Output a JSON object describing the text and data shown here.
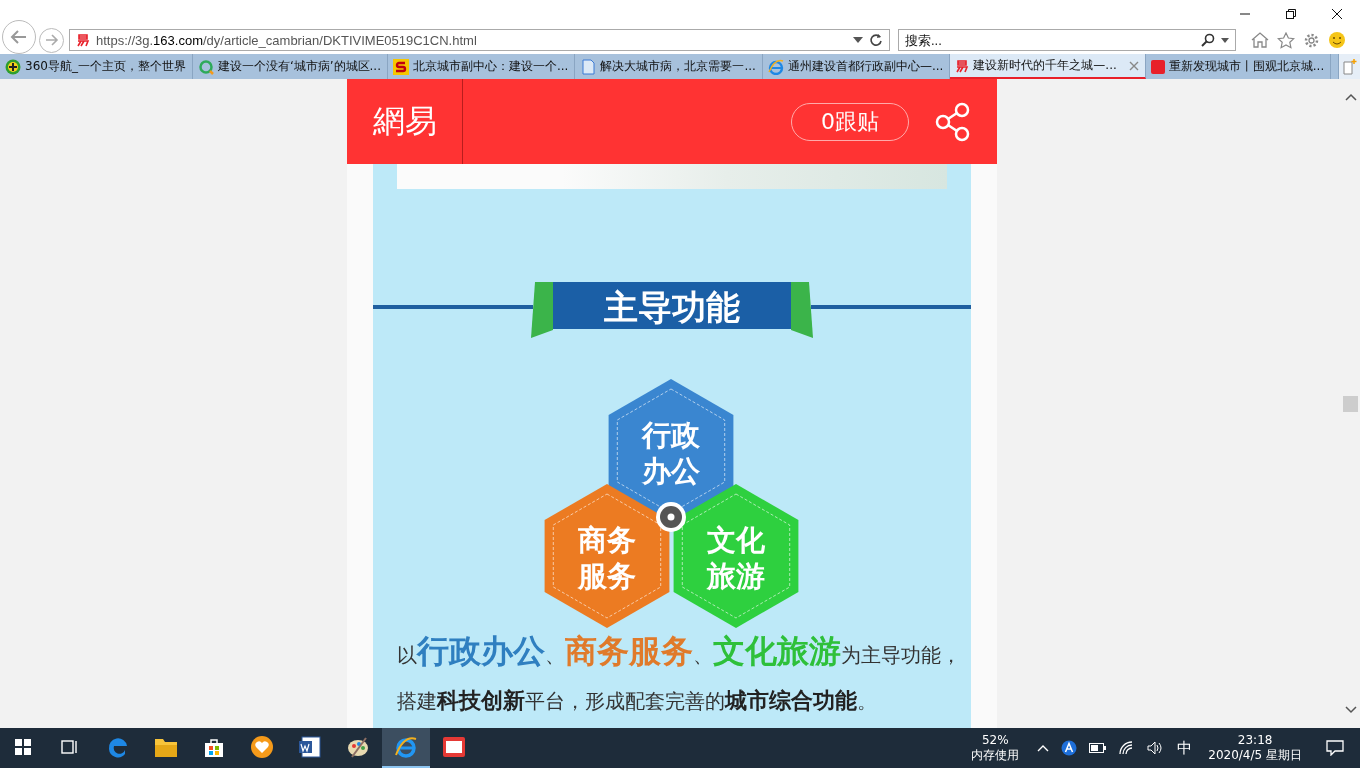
{
  "address_bar": {
    "url_prefix": "https://3g.",
    "url_domain": "163.com",
    "url_path": "/dy/article_cambrian/DKTIVIME0519C1CN.html"
  },
  "search": {
    "placeholder": "搜索..."
  },
  "tabs": [
    {
      "kind": "plus",
      "title": "360导航_一个主页，整个世界",
      "selected": false
    },
    {
      "kind": "ring",
      "title": "建设一个没有‘城市病’的城区...",
      "selected": false
    },
    {
      "kind": "s",
      "title": "北京城市副中心：建设一个...",
      "selected": false
    },
    {
      "kind": "doc",
      "title": "解决大城市病，北京需要一...",
      "selected": false
    },
    {
      "kind": "ie",
      "title": "通州建设首都行政副中心—...",
      "selected": false
    },
    {
      "kind": "netease",
      "title": "建设新时代的千年之城—...",
      "selected": true
    },
    {
      "kind": "toutiao",
      "title": "重新发现城市丨围观北京城...",
      "selected": false
    }
  ],
  "header": {
    "logo": "網易",
    "comments": "0跟贴"
  },
  "infographic": {
    "title": "主导功能",
    "hexagons": [
      {
        "lines": [
          "行政",
          "办公"
        ],
        "color": "#3a86d0"
      },
      {
        "lines": [
          "商务",
          "服务"
        ],
        "color": "#ec7b22"
      },
      {
        "lines": [
          "文化",
          "旅游"
        ],
        "color": "#2ed03f"
      }
    ],
    "paragraph": [
      {
        "text": "以",
        "bold": false
      },
      {
        "text": "行政办公",
        "bold": true,
        "color": "#2f7fc0"
      },
      {
        "text": "、",
        "bold": false
      },
      {
        "text": "商务服务",
        "bold": true,
        "color": "#e07a2a"
      },
      {
        "text": "、",
        "bold": false
      },
      {
        "text": "文化旅游",
        "bold": true,
        "color": "#2ec03a"
      },
      {
        "text": "为主导功能，搭建",
        "bold": false
      },
      {
        "text": "科技创新",
        "bold": true
      },
      {
        "text": "平台，形成配套完善的",
        "bold": false
      },
      {
        "text": "城市综合功能",
        "bold": true
      },
      {
        "text": "。",
        "bold": false
      }
    ]
  },
  "taskbar": {
    "apps": [
      {
        "kind": "edge",
        "selected": false
      },
      {
        "kind": "folder",
        "selected": false
      },
      {
        "kind": "store",
        "selected": false
      },
      {
        "kind": "heart",
        "selected": false
      },
      {
        "kind": "word",
        "selected": false
      },
      {
        "kind": "palette",
        "selected": false
      },
      {
        "kind": "ie",
        "selected": true
      },
      {
        "kind": "eclip",
        "selected": false
      }
    ],
    "memory_percent": "52%",
    "memory_label": "内存使用",
    "ime": "中",
    "time": "23:18",
    "date": "2020/4/5 星期日"
  }
}
